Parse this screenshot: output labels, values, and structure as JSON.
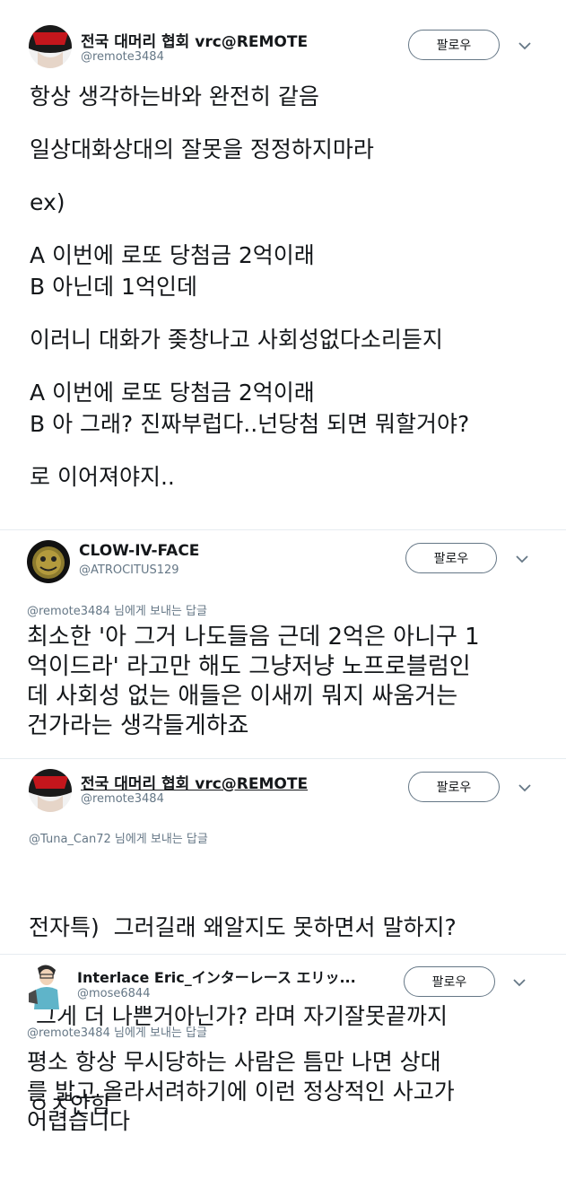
{
  "tweets": [
    {
      "name": "전국 대머리 협회 vrc@REMOTE",
      "handle": "@remote3484",
      "follow_label": "팔로우",
      "lines": [
        "항상 생각하는바와 완전히 같음",
        "",
        "일상대화상대의 잘못을 정정하지마라",
        "",
        "ex)",
        "",
        "A 이번에 로또 당첨금 2억이래",
        "B 아닌데 1억인데",
        "",
        "이러니 대화가 좆창나고 사회성없다소리듣지",
        "",
        "A 이번에 로또 당첨금 2억이래",
        "B 아 그래? 진짜부럽다..넌당첨 되면 뭐할거야?",
        "",
        "로 이어져야지.."
      ]
    },
    {
      "name": "CLOW-IV-FACE",
      "handle": "@ATROCITUS129",
      "follow_label": "팔로우",
      "reply_to": "@remote3484 님에게 보내는 답글",
      "lines": [
        "최소한 '아 그거 나도들음 근데 2억은 아니구 1",
        "억이드라' 라고만 해도 그냥저냥 노프로블럼인",
        "데 사회성 없는 애들은 이새끼 뭐지 싸움거는",
        "건가라는 생각들게하죠"
      ]
    },
    {
      "name": "전국 대머리 협회 vrc@REMOTE",
      "handle": "@remote3484",
      "follow_label": "팔로우",
      "reply_to": "@Tuna_Can72 님에게 보내는 답글",
      "lines": [
        "전자특)  그러길래 왜알지도 못하면서 말하지?",
        " 그게 더 나쁜거아닌가? 라며 자기잘못끝까지",
        "ㅇㅈ안함"
      ]
    },
    {
      "name": "Interlace Eric_インターレース エリッ...",
      "handle": "@mose6844",
      "follow_label": "팔로우",
      "reply_to": "@remote3484 님에게 보내는 답글",
      "lines": [
        "평소 항상 무시당하는 사람은 틈만 나면 상대",
        "를 밟고 올라서려하기에 이런 정상적인 사고가",
        "어렵습니다"
      ]
    }
  ],
  "icons": {
    "chevron": "chevron-down-icon"
  },
  "colors": {
    "text": "#14171a",
    "secondary": "#657786",
    "divider": "#e6ecf0"
  }
}
